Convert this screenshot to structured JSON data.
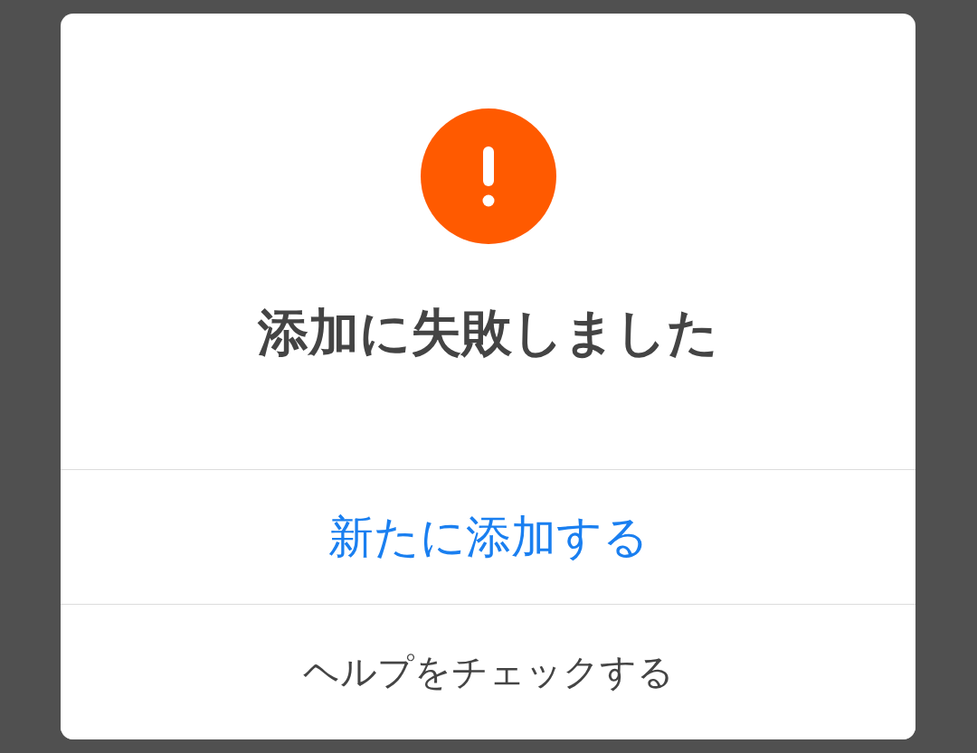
{
  "dialog": {
    "title": "添加に失敗しました",
    "buttons": [
      {
        "label": "新たに添加する",
        "kind": "primary"
      },
      {
        "label": "ヘルプをチェックする",
        "kind": "secondary"
      }
    ]
  }
}
